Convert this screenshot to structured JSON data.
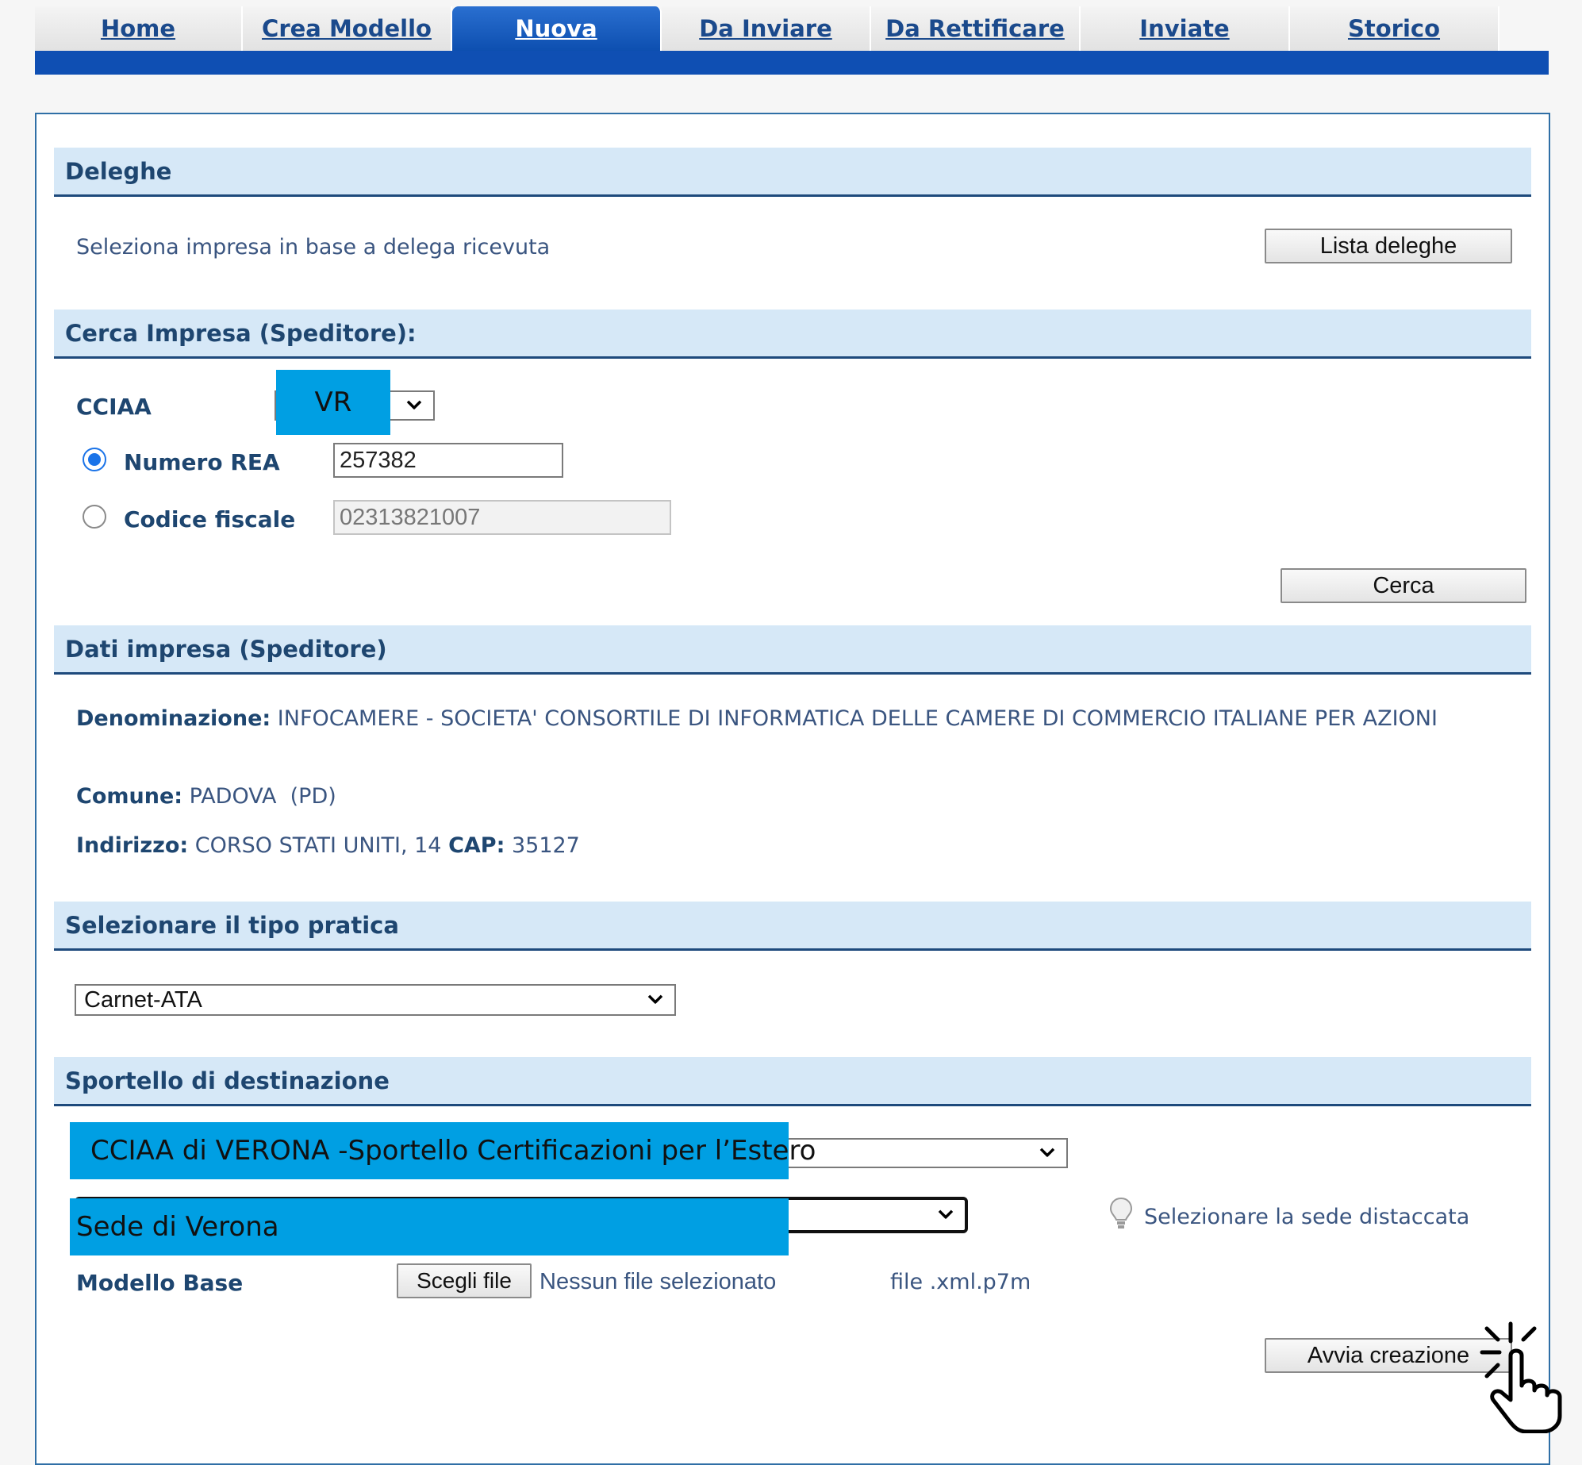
{
  "nav": {
    "tabs": [
      {
        "label": "Home",
        "active": false
      },
      {
        "label": "Crea Modello",
        "active": false
      },
      {
        "label": "Nuova",
        "active": true
      },
      {
        "label": "Da Inviare",
        "active": false
      },
      {
        "label": "Da Rettificare",
        "active": false
      },
      {
        "label": "Inviate",
        "active": false
      },
      {
        "label": "Storico",
        "active": false
      }
    ]
  },
  "deleghe": {
    "header": "Deleghe",
    "text": "Seleziona impresa in base a delega ricevuta",
    "button": "Lista deleghe"
  },
  "cerca": {
    "header": "Cerca Impresa (Speditore):",
    "cciaa_label": "CCIAA",
    "cciaa_value": "VR",
    "rea_label": "Numero REA",
    "rea_value": "257382",
    "cf_label": "Codice fiscale",
    "cf_value": "02313821007",
    "selected_radio": "rea",
    "button": "Cerca"
  },
  "dati": {
    "header": "Dati impresa (Speditore)",
    "denominazione_label": "Denominazione:",
    "denominazione_value": "INFOCAMERE - SOCIETA' CONSORTILE DI INFORMATICA DELLE CAMERE DI COMMERCIO ITALIANE PER AZIONI",
    "comune_label": "Comune:",
    "comune_value": "PADOVA  (PD)",
    "indirizzo_label": "Indirizzo:",
    "indirizzo_value": "CORSO STATI UNITI, 14",
    "cap_label": "CAP:",
    "cap_value": "35127"
  },
  "pratica": {
    "header": "Selezionare il tipo pratica",
    "selected": "Carnet-ATA"
  },
  "sportello": {
    "header": "Sportello di destinazione",
    "sportello_value": "CCIAA di VERONA -Sportello Certificazioni per l’Estero",
    "sede_value": "Sede di Verona",
    "hint": "Selezionare la sede distaccata",
    "modello_label": "Modello Base",
    "file_button": "Scegli file",
    "file_status": "Nessun file selezionato",
    "file_ext": "file .xml.p7m",
    "submit": "Avvia creazione"
  },
  "colors": {
    "nav_blue": "#0f4fb3",
    "header_bg": "#d6e8f7",
    "overlay_blue": "#009fe3"
  }
}
